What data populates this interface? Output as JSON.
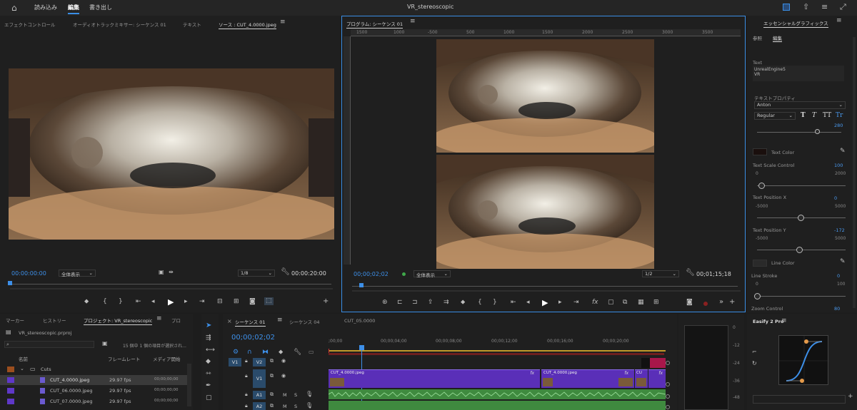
{
  "app": {
    "title": "VR_stereoscopic",
    "menu": [
      "読み込み",
      "編集",
      "書き出し"
    ]
  },
  "source_panel": {
    "tabs": [
      "エフェクトコントロール",
      "オーディオトラックミキサー: シーケンス 01",
      "テキスト",
      "ソース : CUT_4.0000.jpeg"
    ],
    "timecode": "00:00:00:00",
    "zoom": "全体表示",
    "resolution": "1/8",
    "duration": "00:00:20:00"
  },
  "program_panel": {
    "tab": "プログラム: シーケンス 01",
    "timecode": "00;00;02;02",
    "zoom": "全体表示",
    "resolution": "1/2",
    "duration": "00;01;15;18",
    "ruler_labels": [
      "1500",
      "1000",
      "-500",
      "500",
      "1000",
      "1500",
      "2000",
      "2500",
      "3000",
      "3500"
    ]
  },
  "essential_graphics": {
    "title": "エッセンシャルグラフィックス",
    "tabs": [
      "参照",
      "編集"
    ],
    "text_label": "Text",
    "text_lines": [
      "UnrealEngine5",
      "VR"
    ],
    "text_props_label": "テキストプロパティ",
    "font": "Anton",
    "style": "Regular",
    "style_buttons": [
      "T",
      "T",
      "TT",
      "Tr"
    ],
    "font_size": "280",
    "text_color_label": "Text Color",
    "scale_label": "Text Scale Control",
    "scale_value": "100",
    "scale_min": "0",
    "scale_max": "2000",
    "posx_label": "Text Position X",
    "posx_value": "0",
    "posx_min": "-5000",
    "posx_max": "5000",
    "posy_label": "Text Position Y",
    "posy_value": "-172",
    "posy_min": "-5000",
    "posy_max": "5000",
    "line_color_label": "Line Color",
    "line_stroke_label": "Line Stroke",
    "line_stroke_value": "0",
    "line_min": "0",
    "line_max": "100",
    "zoom_control_label": "Zoom Control",
    "zoom_control_value": "80"
  },
  "project_panel": {
    "tabs": [
      "マーカー",
      "ヒストリー",
      "プロジェクト: VR_stereoscopic",
      "プロ"
    ],
    "file": "VR_stereoscopic.prproj",
    "selection_info": "15 個中 1 個の項目が選択され...",
    "columns": [
      "名前",
      "フレームレート",
      "メディア開始"
    ],
    "folder": "Cuts",
    "items": [
      {
        "name": "CUT_4.0000.jpeg",
        "fps": "29.97 fps",
        "start": "00;00;00;00"
      },
      {
        "name": "CUT_06.0000.jpeg",
        "fps": "29.97 fps",
        "start": "00;00;00;00"
      },
      {
        "name": "CUT_07.0000.jpeg",
        "fps": "29.97 fps",
        "start": "00;00;00;00"
      }
    ]
  },
  "timeline": {
    "tabs": [
      "シーケンス 01",
      "シーケンス 04",
      "CUT_05.0000"
    ],
    "timecode": "00;00;02;02",
    "ruler": [
      ";00;00",
      "00;00;04;00",
      "00;00;08;00",
      "00;00;12;00",
      "00;00;16;00",
      "00;00;20;00"
    ],
    "tracks": [
      "V2",
      "V1",
      "A1",
      "A2"
    ],
    "source_tracks": [
      "V1"
    ],
    "clips": [
      "CUT_4.0000.jpeg",
      "CUT_4.0000.jpeg",
      "CU"
    ],
    "fx_marks": [
      "fx",
      "fx",
      "fx",
      "fx"
    ],
    "audio_buttons": [
      "M",
      "S"
    ]
  },
  "meter": {
    "labels": [
      "0",
      "-12",
      "-24",
      "-36",
      "-48"
    ]
  },
  "easify": {
    "title": "Easify 2 Pro"
  }
}
